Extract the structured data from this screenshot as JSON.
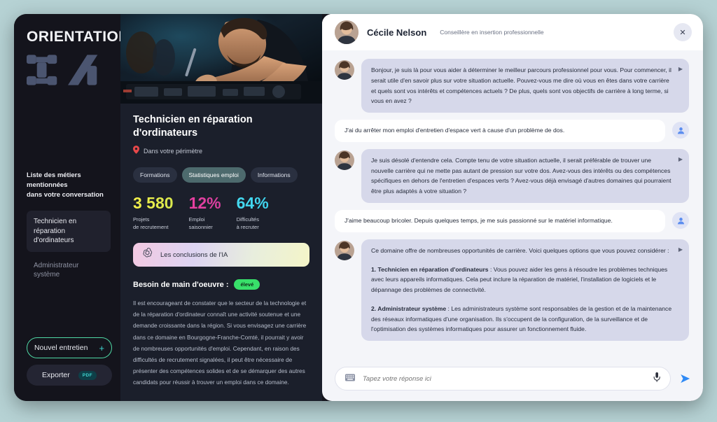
{
  "sidebar": {
    "brand_word": "ORIENTATION",
    "brand_mark_icon": "ia-logo-icon",
    "heading": "Liste des métiers\nmentionnées\ndans votre conversation",
    "jobs": [
      {
        "label": "Technicien en réparation d'ordinateurs",
        "active": true
      },
      {
        "label": "Administrateur système",
        "active": false
      }
    ],
    "new_interview_label": "Nouvel entretien",
    "new_interview_icon": "plus-icon",
    "export_label": "Exporter",
    "export_badge": "PDF"
  },
  "middle": {
    "hero_image_alt": "technicien réparant un ordinateur portable",
    "job_title": "Technicien en réparation d'ordinateurs",
    "location_icon": "map-pin-icon",
    "location_text": "Dans votre périmètre",
    "tabs": [
      {
        "label": "Formations",
        "active": false
      },
      {
        "label": "Statistiques emploi",
        "active": true
      },
      {
        "label": "Informations",
        "active": false
      }
    ],
    "stats": [
      {
        "value": "3 580",
        "label": "Projets\nde recrutement",
        "color": "#f4f04a"
      },
      {
        "value": "12%",
        "label": "Emploi\nsaisonnier",
        "color": "#e83fa0"
      },
      {
        "value": "64%",
        "label": "Difficultés\nà recruter",
        "color": "#45d9ef"
      }
    ],
    "ai_banner": {
      "icon": "openai-logo-icon",
      "text": "Les conclusions de l'IA"
    },
    "need_label": "Besoin de main d'oeuvre :",
    "need_badge": "élevé",
    "need_body": "Il est encourageant de constater que le secteur de la technologie et de la réparation d'ordinateur connaît une activité soutenue et une demande croissante dans la région. Si vous envisagez une carrière dans ce domaine en Bourgogne-Franche-Comté, il pourrait y avoir de nombreuses opportunités d'emploi. Cependant, en raison des difficultés de recrutement signalées, il peut être nécessaire de présenter des compétences solides et de se démarquer des autres candidats pour réussir à trouver un emploi dans ce domaine."
  },
  "chat": {
    "advisor_name": "Cécile Nelson",
    "advisor_role": "Conseillère en insertion professionnelle",
    "advisor_avatar_icon": "advisor-avatar-icon",
    "close_icon": "close-icon",
    "messages": [
      {
        "from": "bot",
        "text": "Bonjour, je suis là pour vous aider à déterminer le meilleur parcours professionnel pour vous. Pour commencer, il serait utile d'en savoir plus sur votre situation actuelle. Pouvez-vous me dire où vous en êtes dans votre carrière et quels sont vos intérêts et compétences actuels ? De plus, quels sont vos objectifs de carrière à long terme, si vous en avez ?",
        "play_icon": "play-audio-icon"
      },
      {
        "from": "user",
        "text": "J'ai du arrêter mon emploi d'entretien d'espace vert à cause d'un problème de dos.",
        "avatar_icon": "user-avatar-icon"
      },
      {
        "from": "bot",
        "text": "Je suis désolé d'entendre cela. Compte tenu de votre situation actuelle, il serait préférable de trouver une nouvelle carrière qui ne mette pas autant de pression sur votre dos. Avez-vous des intérêts ou des compétences spécifiques en dehors de l'entretien d'espaces verts ? Avez-vous déjà envisagé d'autres domaines qui pourraient être plus adaptés à votre situation ?",
        "play_icon": "play-audio-icon"
      },
      {
        "from": "user",
        "text": "J'aime beaucoup bricoler. Depuis quelques temps, je me suis passionné sur le matériel informatique.",
        "avatar_icon": "user-avatar-icon"
      },
      {
        "from": "bot",
        "intro": "Ce domaine offre de nombreuses opportunités de carrière. Voici quelques options que vous pouvez considérer :",
        "item1_title": "1. Technicien en réparation d'ordinateurs",
        "item1_body": " : Vous pouvez aider les gens à résoudre les problèmes techniques avec leurs appareils informatiques. Cela peut inclure la réparation de matériel, l'installation de logiciels et le dépannage des problèmes de connectivité.",
        "item2_title": "2. Administrateur système",
        "item2_body": " : Les administrateurs système sont responsables de la gestion et de la maintenance des réseaux informatiques d'une organisation. Ils s'occupent de la configuration, de la surveillance et de l'optimisation des systèmes informatiques pour assurer un fonctionnement fluide.",
        "play_icon": "play-audio-icon"
      }
    ],
    "input_placeholder": "Tapez votre réponse ici",
    "keyboard_icon": "keyboard-icon",
    "mic_icon": "microphone-icon",
    "send_icon": "send-arrow-icon"
  },
  "colors": {
    "page_background": "#b6d2d4",
    "window_background": "#14141c",
    "middle_panel": "#1b1f2b",
    "chat_background": "#f4f5f9",
    "accent_teal": "#3fd5d0",
    "accent_green": "#4fd9a5",
    "badge_green": "#38e06a",
    "send_blue": "#2f8af5"
  }
}
